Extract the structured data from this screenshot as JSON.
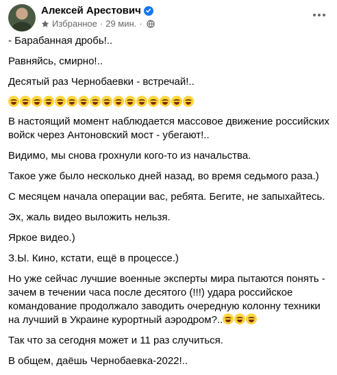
{
  "post": {
    "author": "Алексей Арестович",
    "audience": "Избранное",
    "separator": "·",
    "time": "29 мин.",
    "paragraphs": {
      "p1": "- Барабанная дробь!..",
      "p2": "Равняйсь, смирно!..",
      "p3": "Десятый раз Чернобаевки - встречай!..",
      "p4": "В настоящий момент наблюдается массовое движение российских войск через Антоновский мост - убегают!..",
      "p5": "Видимо, мы снова грохнули кого-то из начальства.",
      "p6": "Такое уже было несколько дней назад, во время седьмого раза.)",
      "p7": "С месяцем начала операции вас, ребята. Бегите, не запыхайтесь.",
      "p8": "Эх, жаль видео выложить нельзя.",
      "p9": "Яркое видео.)",
      "p10": "З.Ы. Кино, кстати, ещё в процессе.)",
      "p11": "Но уже сейчас лучшие военные эксперты мира пытаются понять - зачем в течении часа после десятого (!!!) удара российское командование продолжало заводить очередную колонну техники на лучший в Украине курортный аэродром?..",
      "p12": "Так что за сегодня может и 11 раз случиться.",
      "p13": "В общем, даёшь Чернобаевка-2022!.."
    },
    "emoji_row_count": 16,
    "inline_emoji_count": 3,
    "emoji_name": "rolling-on-floor-laughing"
  }
}
